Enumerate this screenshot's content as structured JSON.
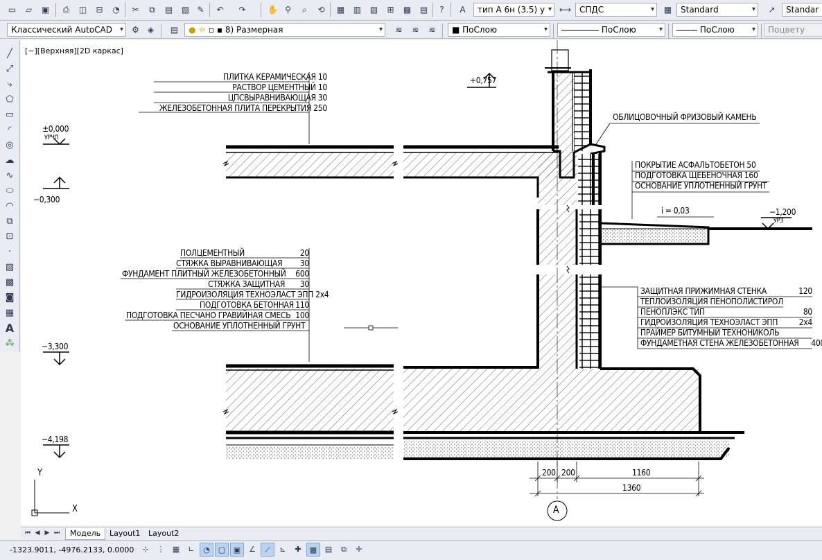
{
  "toolbar_top": {
    "text_style": "тип А 6н (3.5) у",
    "dim_style": "СПДС",
    "table_style": "Standard",
    "mleader_style": "Standar",
    "icons": [
      "new-icon",
      "open-icon",
      "save-icon",
      "print-icon",
      "preview-icon",
      "publish-icon",
      "3d-print-icon",
      "cut-icon",
      "copy-icon",
      "paste-icon",
      "match-properties-icon",
      "undo-icon",
      "redo-icon",
      "pan-icon",
      "zoom-realtime-icon",
      "zoom-window-icon",
      "zoom-previous-icon",
      "properties-icon",
      "design-center-icon",
      "tool-palettes-icon",
      "sheet-set-icon",
      "markup-icon",
      "calculator-icon",
      "help-icon"
    ]
  },
  "toolbar_second": {
    "workspace": "Классический AutoCAD",
    "layer": "8) Размерная",
    "color": "ПоСлою",
    "linetype": "ПоСлою",
    "lineweight": "ПоСлою",
    "plot_style": "Поцвету"
  },
  "viewport": {
    "label": "[−][Верхняя][2D каркас]"
  },
  "drawing": {
    "slab_layers": [
      "ПЛИТКА КЕРАМИЧЕСКАЯ   10",
      "РАСТВОР  ЦЕМЕНТНЫЙ   10",
      "ЦПСВЫРАВНИВАЮЩАЯ   30",
      "ЖЕЛЕЗОБЕТОННАЯ ПЛИТА ПЕРЕКРЫТИЯ 250"
    ],
    "floor_layers": [
      {
        "name": "ПОЛЦЕМЕНТНЫЙ",
        "value": "20"
      },
      {
        "name": "СТЯЖКА  ВЫРАВНИВАЮЩАЯ",
        "value": "30"
      },
      {
        "name": "ФУНДАМЕНТ ПЛИТНЫЙ  ЖЕЛЕЗОБЕТОННЫЙ",
        "value": "600"
      },
      {
        "name": "СТЯЖКА  ЗАЩИТНАЯ",
        "value": "30"
      },
      {
        "name": "ГИДРОИЗОЛЯЦИЯ  ТЕХНОЭЛАСТ  ЭПП 2х4",
        "value": ""
      },
      {
        "name": "ПОДГОТОВКА  БЕТОННАЯ",
        "value": "110"
      },
      {
        "name": "ПОДГОТОВКА ПЕСЧАНО ГРАВИЙНАЯ  СМЕСЬ",
        "value": "100"
      },
      {
        "name": "ОСНОВАНИЕ  УПЛОТНЕННЫЙ  ГРУНТ",
        "value": ""
      }
    ],
    "facing_label": "ОБЛИЦОВОЧНЫЙ  ФРИЗОВЫЙ  КАМЕНЬ",
    "pavement_layers": [
      "ПОКРЫТИЕ  АСФАЛЬТОБЕТОН  50",
      "ПОДГОТОВКА  ЩЕБЕНОЧНАЯ 160",
      "ОСНОВАНИЕ  УПЛОТНЕННЫЙ  ГРУНТ"
    ],
    "wall_layers": [
      {
        "name": "ЗАЩИТНАЯ  ПРИЖИМНАЯ  СТЕНКА",
        "value": "120"
      },
      {
        "name": "ТЕПЛОИЗОЛЯЦИЯ  ПЕНОПОЛИСТИРОЛ",
        "value": ""
      },
      {
        "name": "ПЕНОПЛЭКС  ТИП",
        "value": "80"
      },
      {
        "name": "ГИДРОИЗОЛЯЦИЯ   ТЕХНОЭЛАСТ  ЭПП",
        "value": "2х4"
      },
      {
        "name": "ПРАЙМЕР  БИТУМНЫЙ  ТЕХНОНИКОЛЬ",
        "value": ""
      },
      {
        "name": "ФУНДАМЕТНАЯ  СТЕНА  ЖЕЛЕЗОБЕТОННАЯ",
        "value": "400"
      }
    ],
    "slope": "i  =  0,03",
    "levels": {
      "zero": "±0,000",
      "zero_sub": "УРЧП",
      "m0300": "−0,300",
      "m3300": "−3,300",
      "m4198": "−4,198",
      "p0757": "+0,757",
      "m1200": "−1,200",
      "m1200_sub": "УРЗ"
    },
    "dims": {
      "d1": "200",
      "d2": "200",
      "d3": "1160",
      "total": "1360"
    },
    "axis": "А",
    "ucs_x": "X",
    "ucs_y": "Y"
  },
  "layout_tabs": [
    "Модель",
    "Layout1",
    "Layout2"
  ],
  "status": {
    "coords": "-1323.9011, -4976.2133, 0.0000"
  }
}
